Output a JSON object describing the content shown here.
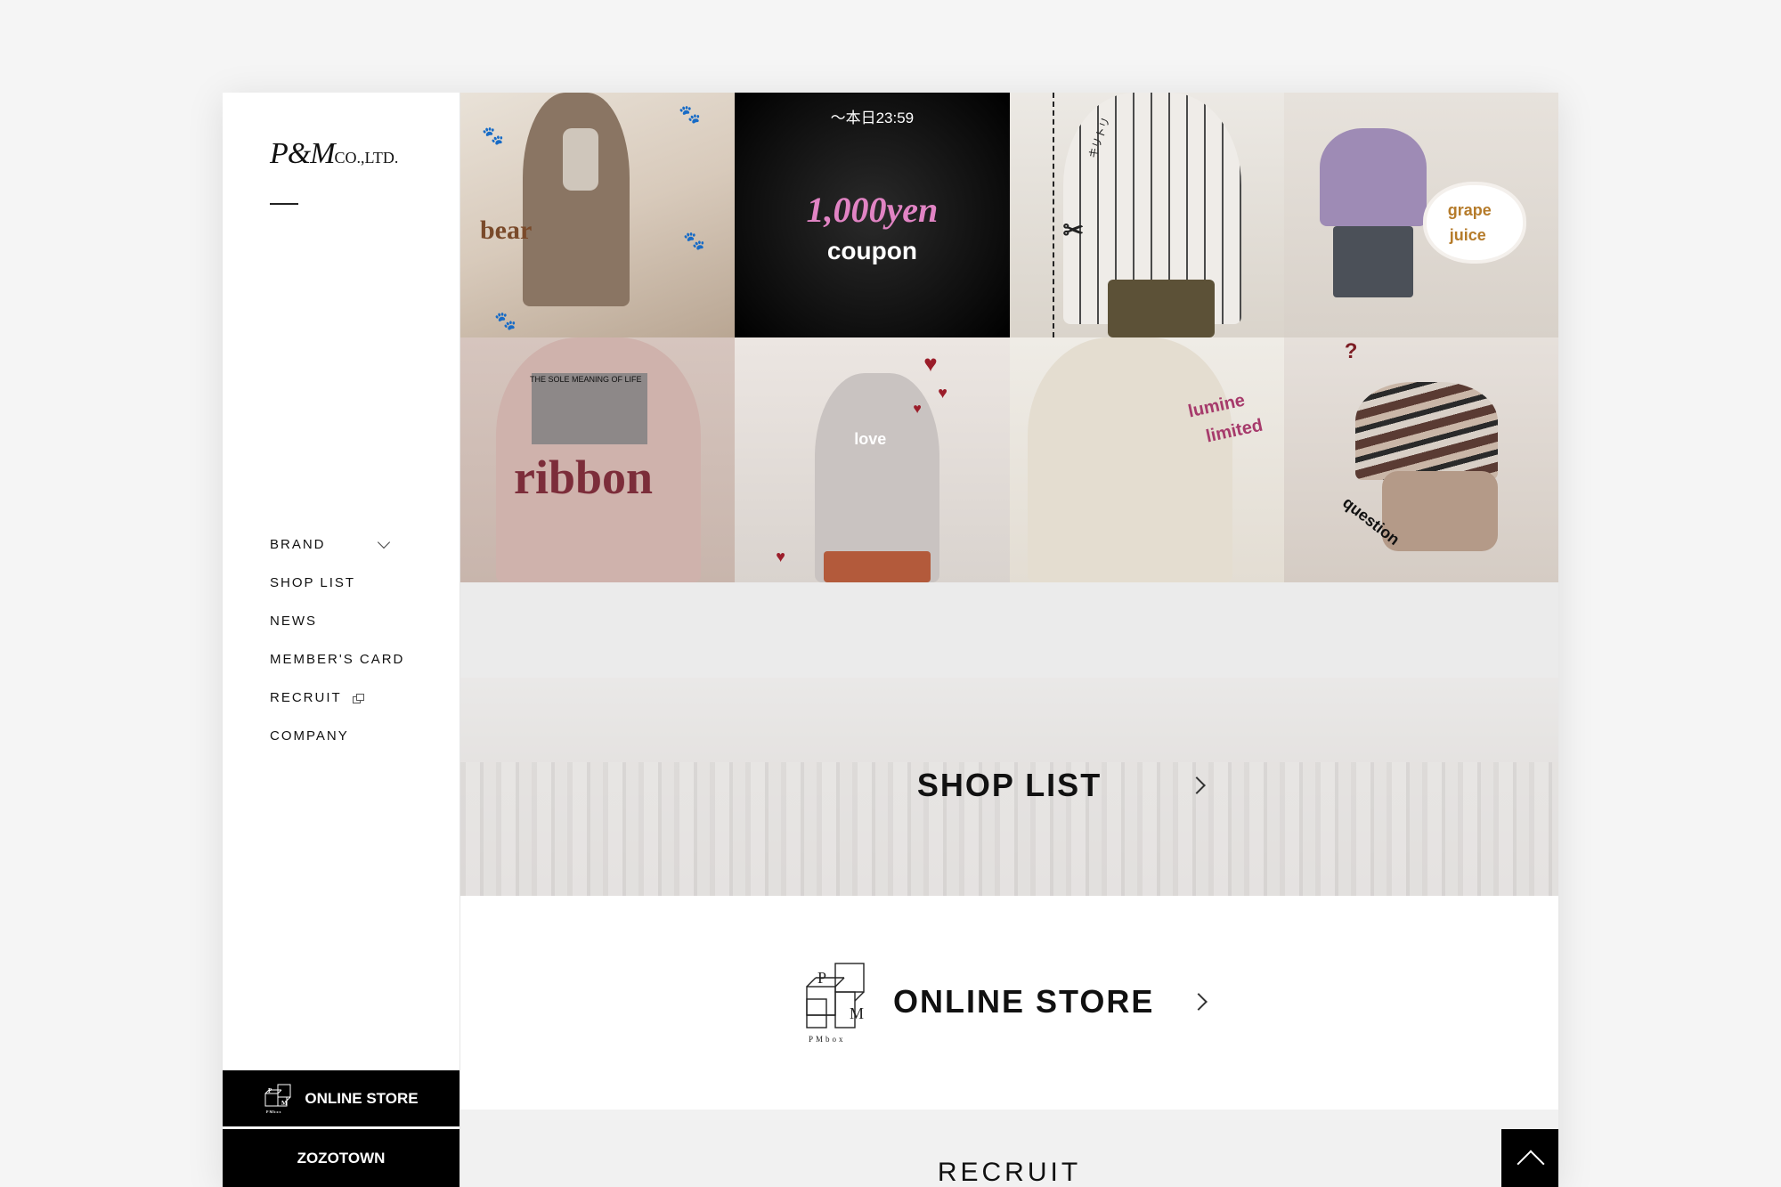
{
  "sidebar": {
    "logo_main": "P&M",
    "logo_sub": "CO.,LTD.",
    "nav": [
      {
        "label": "BRAND"
      },
      {
        "label": "SHOP LIST"
      },
      {
        "label": "NEWS"
      },
      {
        "label": "MEMBER'S CARD"
      },
      {
        "label": "RECRUIT"
      },
      {
        "label": "COMPANY"
      }
    ],
    "online_store_label": "ONLINE STORE",
    "zozotown_label": "ZOZOTOWN",
    "pmbox_letter_p": "P",
    "pmbox_letter_m": "M",
    "pmbox_caption": "PMbox"
  },
  "tiles": [
    {
      "label": "bear",
      "color": "#7a4a2a"
    },
    {
      "top_text": "〜本日23:59",
      "label": "1,000yen",
      "sub": "coupon",
      "color": "#e184c4"
    },
    {
      "label": "キリトリ",
      "color": "#222222"
    },
    {
      "label": "grape",
      "label2": "juice",
      "color": "#b57b2a"
    },
    {
      "label": "ribbon",
      "top_text": "THE SOLE MEANING OF LIFE",
      "color": "#7c2d3a"
    },
    {
      "label": "love",
      "color": "#ffffff"
    },
    {
      "label": "lumine",
      "label2": "limited",
      "color": "#a63a6b"
    },
    {
      "label": "question",
      "top_text": "?",
      "color": "#111111"
    }
  ],
  "shop_banner": {
    "title": "SHOP LIST"
  },
  "online_store": {
    "title": "ONLINE STORE",
    "box_caption": "PMbox",
    "letter_p": "P",
    "letter_m": "M"
  },
  "recruit": {
    "title": "RECRUIT"
  },
  "colors": {
    "accent_black": "#000000",
    "page_bg": "#f5f5f5",
    "band_gray": "#ebebeb"
  }
}
